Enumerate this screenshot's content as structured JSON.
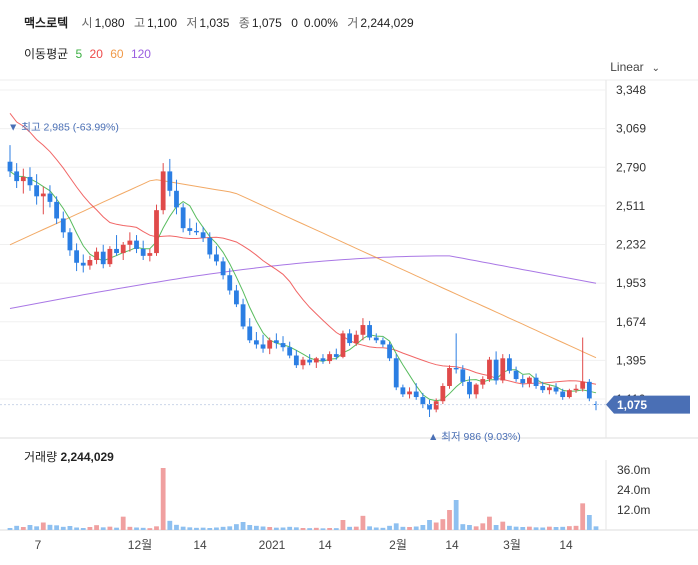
{
  "header": {
    "name": "맥스로텍",
    "open_label": "시",
    "open": "1,080",
    "high_label": "고",
    "high": "1,100",
    "low_label": "저",
    "low": "1,035",
    "close_label": "종",
    "close": "1,075",
    "change": "0",
    "change_pct": "0.00%",
    "volume_label": "거",
    "volume": "2,244,029"
  },
  "ma": {
    "label": "이동평균",
    "items": [
      {
        "period": "5",
        "color": "#3cb043"
      },
      {
        "period": "20",
        "color": "#ee4b4b"
      },
      {
        "period": "60",
        "color": "#f09a4a"
      },
      {
        "period": "120",
        "color": "#9a5fe0"
      }
    ]
  },
  "scale_mode": "Linear",
  "price_axis": {
    "ticks": [
      "3,348",
      "3,069",
      "2,790",
      "2,511",
      "2,232",
      "1,953",
      "1,674",
      "1,395",
      "1,116"
    ],
    "tick_values": [
      3348,
      3069,
      2790,
      2511,
      2232,
      1953,
      1674,
      1395,
      1116
    ],
    "current_label": "1,075",
    "current_value": 1075,
    "current_color": "#4a6fb5"
  },
  "annotations": {
    "high": {
      "text": "최고 2,985 (-63.99%)",
      "value": 2985
    },
    "low": {
      "text": "최저 986 (9.03%)",
      "value": 986
    }
  },
  "volume_header": {
    "label": "거래량",
    "value": "2,244,029"
  },
  "volume_axis": {
    "ticks": [
      "36.0m",
      "24.0m",
      "12.0m"
    ],
    "tick_values": [
      36,
      24,
      12
    ]
  },
  "x_axis": {
    "labels": [
      "7",
      "12월",
      "14",
      "2021",
      "14",
      "2월",
      "14",
      "3월",
      "14"
    ]
  },
  "colors": {
    "up": "#e04a4a",
    "down": "#2b7ee3",
    "up_vol": "#f0a0a0",
    "down_vol": "#8ec0f0",
    "ma5": "#3cb043",
    "ma20": "#ee4b4b",
    "ma60": "#f09a4a",
    "ma120": "#9a5fe0"
  },
  "chart_data": {
    "type": "candlestick",
    "y_unit": "KRW",
    "ylim": [
      986,
      3348
    ],
    "x_labels": [
      "7",
      "12월",
      "14",
      "2021",
      "14",
      "2월",
      "14",
      "3월",
      "14"
    ],
    "candles": [
      [
        2830,
        2950,
        2720,
        2760
      ],
      [
        2760,
        2820,
        2640,
        2690
      ],
      [
        2690,
        2780,
        2600,
        2720
      ],
      [
        2720,
        2790,
        2620,
        2660
      ],
      [
        2660,
        2740,
        2520,
        2580
      ],
      [
        2580,
        2650,
        2450,
        2600
      ],
      [
        2600,
        2660,
        2500,
        2540
      ],
      [
        2540,
        2580,
        2380,
        2420
      ],
      [
        2420,
        2470,
        2280,
        2320
      ],
      [
        2320,
        2350,
        2150,
        2190
      ],
      [
        2190,
        2240,
        2040,
        2100
      ],
      [
        2100,
        2160,
        2030,
        2080
      ],
      [
        2080,
        2150,
        2050,
        2120
      ],
      [
        2120,
        2210,
        2090,
        2180
      ],
      [
        2180,
        2230,
        2060,
        2090
      ],
      [
        2090,
        2220,
        2070,
        2200
      ],
      [
        2200,
        2300,
        2150,
        2170
      ],
      [
        2170,
        2250,
        2120,
        2230
      ],
      [
        2230,
        2320,
        2180,
        2260
      ],
      [
        2260,
        2300,
        2170,
        2200
      ],
      [
        2200,
        2260,
        2120,
        2150
      ],
      [
        2150,
        2200,
        2110,
        2170
      ],
      [
        2170,
        2520,
        2150,
        2480
      ],
      [
        2480,
        2820,
        2450,
        2760
      ],
      [
        2760,
        2850,
        2580,
        2620
      ],
      [
        2620,
        2700,
        2450,
        2500
      ],
      [
        2500,
        2530,
        2320,
        2350
      ],
      [
        2350,
        2420,
        2300,
        2330
      ],
      [
        2330,
        2390,
        2300,
        2320
      ],
      [
        2320,
        2360,
        2250,
        2280
      ],
      [
        2280,
        2320,
        2130,
        2160
      ],
      [
        2160,
        2220,
        2080,
        2110
      ],
      [
        2110,
        2140,
        1980,
        2010
      ],
      [
        2010,
        2060,
        1870,
        1900
      ],
      [
        1900,
        1940,
        1780,
        1800
      ],
      [
        1800,
        1840,
        1620,
        1640
      ],
      [
        1640,
        1700,
        1520,
        1540
      ],
      [
        1540,
        1600,
        1480,
        1510
      ],
      [
        1510,
        1580,
        1450,
        1480
      ],
      [
        1480,
        1560,
        1440,
        1540
      ],
      [
        1540,
        1590,
        1480,
        1520
      ],
      [
        1520,
        1570,
        1460,
        1490
      ],
      [
        1490,
        1530,
        1410,
        1430
      ],
      [
        1430,
        1470,
        1340,
        1360
      ],
      [
        1360,
        1420,
        1330,
        1400
      ],
      [
        1400,
        1440,
        1360,
        1380
      ],
      [
        1380,
        1420,
        1340,
        1410
      ],
      [
        1410,
        1440,
        1370,
        1390
      ],
      [
        1390,
        1460,
        1370,
        1440
      ],
      [
        1440,
        1480,
        1400,
        1420
      ],
      [
        1420,
        1610,
        1410,
        1590
      ],
      [
        1590,
        1620,
        1500,
        1520
      ],
      [
        1520,
        1610,
        1500,
        1580
      ],
      [
        1580,
        1700,
        1540,
        1650
      ],
      [
        1650,
        1680,
        1540,
        1560
      ],
      [
        1560,
        1590,
        1520,
        1540
      ],
      [
        1540,
        1560,
        1490,
        1510
      ],
      [
        1510,
        1530,
        1390,
        1410
      ],
      [
        1410,
        1440,
        1180,
        1200
      ],
      [
        1200,
        1220,
        1130,
        1150
      ],
      [
        1150,
        1200,
        1120,
        1170
      ],
      [
        1170,
        1230,
        1110,
        1130
      ],
      [
        1130,
        1160,
        1050,
        1080
      ],
      [
        1080,
        1110,
        986,
        1040
      ],
      [
        1040,
        1120,
        1020,
        1100
      ],
      [
        1100,
        1230,
        1080,
        1210
      ],
      [
        1210,
        1360,
        1190,
        1340
      ],
      [
        1340,
        1590,
        1300,
        1330
      ],
      [
        1330,
        1360,
        1210,
        1240
      ],
      [
        1240,
        1280,
        1120,
        1150
      ],
      [
        1150,
        1230,
        1120,
        1220
      ],
      [
        1220,
        1280,
        1190,
        1260
      ],
      [
        1260,
        1420,
        1240,
        1400
      ],
      [
        1400,
        1460,
        1220,
        1250
      ],
      [
        1250,
        1440,
        1230,
        1410
      ],
      [
        1410,
        1440,
        1300,
        1320
      ],
      [
        1320,
        1350,
        1240,
        1260
      ],
      [
        1260,
        1290,
        1200,
        1230
      ],
      [
        1230,
        1280,
        1200,
        1270
      ],
      [
        1270,
        1300,
        1190,
        1210
      ],
      [
        1210,
        1240,
        1160,
        1180
      ],
      [
        1180,
        1220,
        1150,
        1200
      ],
      [
        1200,
        1230,
        1150,
        1170
      ],
      [
        1170,
        1190,
        1110,
        1130
      ],
      [
        1130,
        1190,
        1120,
        1180
      ],
      [
        1180,
        1220,
        1160,
        1190
      ],
      [
        1190,
        1560,
        1170,
        1240
      ],
      [
        1240,
        1260,
        1100,
        1120
      ],
      [
        1080,
        1100,
        1035,
        1075
      ]
    ],
    "volume_millions": [
      1.2,
      2.5,
      1.8,
      3.0,
      2.2,
      4.5,
      3.1,
      2.8,
      1.9,
      2.4,
      1.5,
      1.2,
      1.8,
      2.9,
      1.6,
      2.0,
      1.4,
      8.0,
      1.9,
      1.5,
      1.3,
      1.1,
      2.2,
      45.0,
      5.5,
      3.1,
      2.0,
      1.6,
      1.3,
      1.4,
      1.2,
      1.5,
      1.9,
      2.2,
      3.5,
      4.8,
      3.0,
      2.5,
      2.1,
      1.8,
      1.4,
      1.5,
      1.9,
      1.6,
      1.2,
      1.1,
      1.3,
      1.0,
      1.2,
      1.1,
      6.0,
      1.9,
      2.0,
      8.5,
      2.2,
      1.5,
      1.3,
      2.5,
      4.0,
      1.9,
      1.8,
      2.1,
      3.0,
      6.0,
      4.5,
      6.5,
      12.0,
      18.0,
      3.5,
      3.0,
      2.2,
      4.0,
      8.0,
      3.0,
      5.0,
      2.5,
      2.0,
      1.8,
      2.0,
      1.6,
      1.5,
      2.0,
      1.8,
      1.9,
      2.3,
      2.5,
      16.0,
      9.0,
      2.2
    ]
  }
}
